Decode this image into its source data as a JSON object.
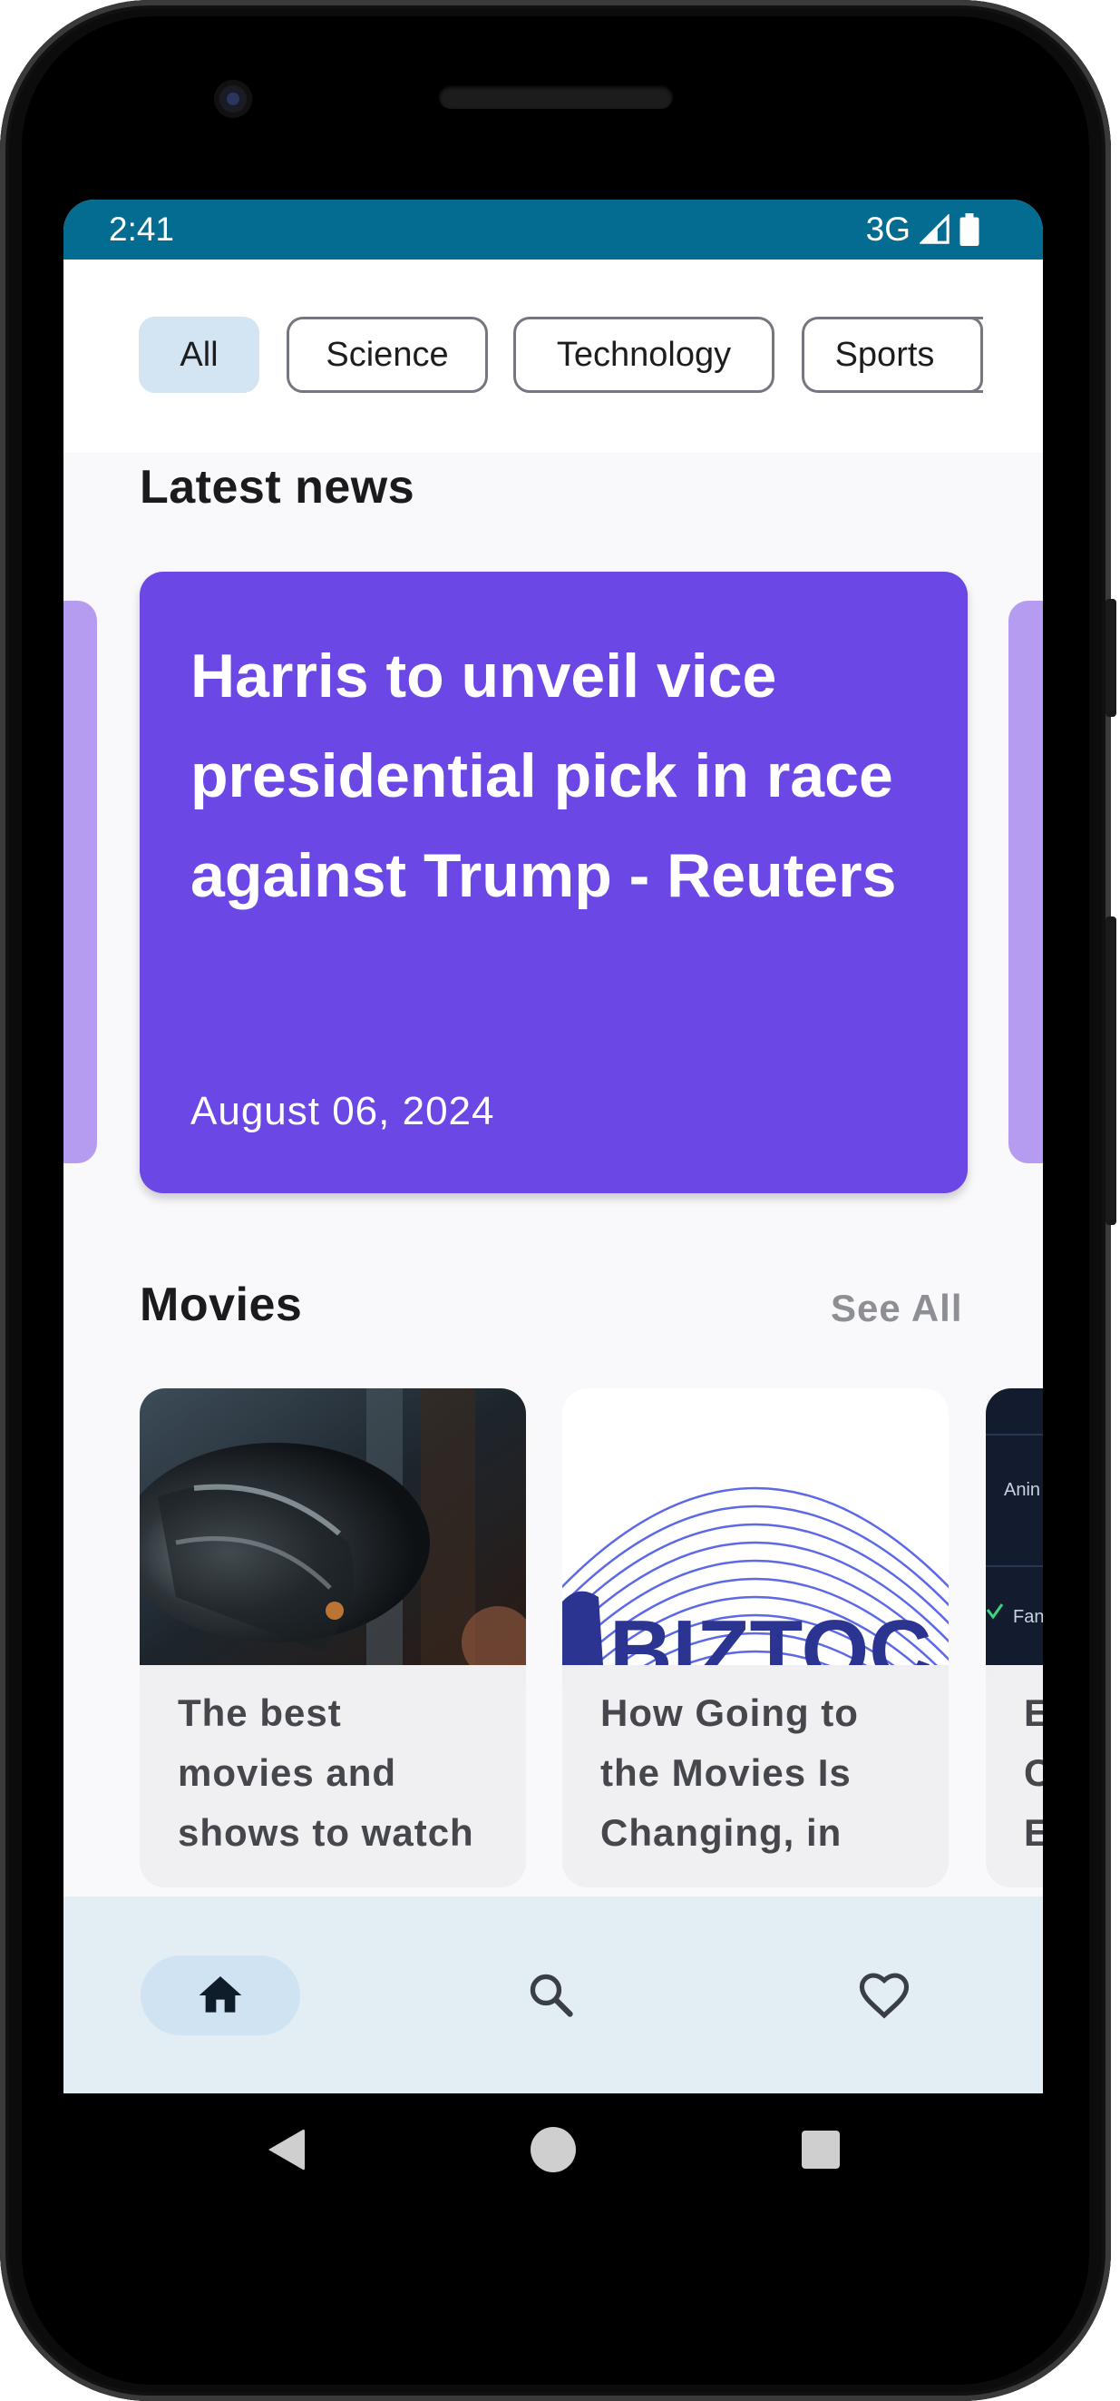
{
  "status_bar": {
    "time": "2:41",
    "network": "3G"
  },
  "filters": {
    "chips": [
      {
        "label": "All",
        "selected": true
      },
      {
        "label": "Science",
        "selected": false
      },
      {
        "label": "Technology",
        "selected": false
      },
      {
        "label": "Sports",
        "selected": false
      }
    ]
  },
  "latest_news": {
    "title": "Latest news",
    "card": {
      "headline": "Harris to unveil vice presidential pick in race against Trump - Reuters",
      "date": "August 06, 2024"
    }
  },
  "movies": {
    "title": "Movies",
    "see_all": "See All",
    "items": [
      {
        "caption_lines": [
          "The best",
          "movies and",
          "shows to watch"
        ]
      },
      {
        "caption_lines": [
          "How Going to",
          "the Movies Is",
          "Changing, in"
        ],
        "image_text": "BIZTOC"
      },
      {
        "caption_lines": [
          "E",
          "C",
          "E"
        ],
        "image_text": [
          "Anin",
          "Fan"
        ]
      }
    ]
  },
  "bottom_nav": {
    "items": [
      {
        "icon": "home-icon",
        "selected": true
      },
      {
        "icon": "search-icon",
        "selected": false
      },
      {
        "icon": "heart-icon",
        "selected": false
      }
    ]
  },
  "colors": {
    "status_bar": "#046c91",
    "hero_card": "#6b47e5",
    "peek_card": "#b59cf0",
    "chip_selected": "#d3e4f3",
    "bottom_nav": "#e3edf4"
  }
}
